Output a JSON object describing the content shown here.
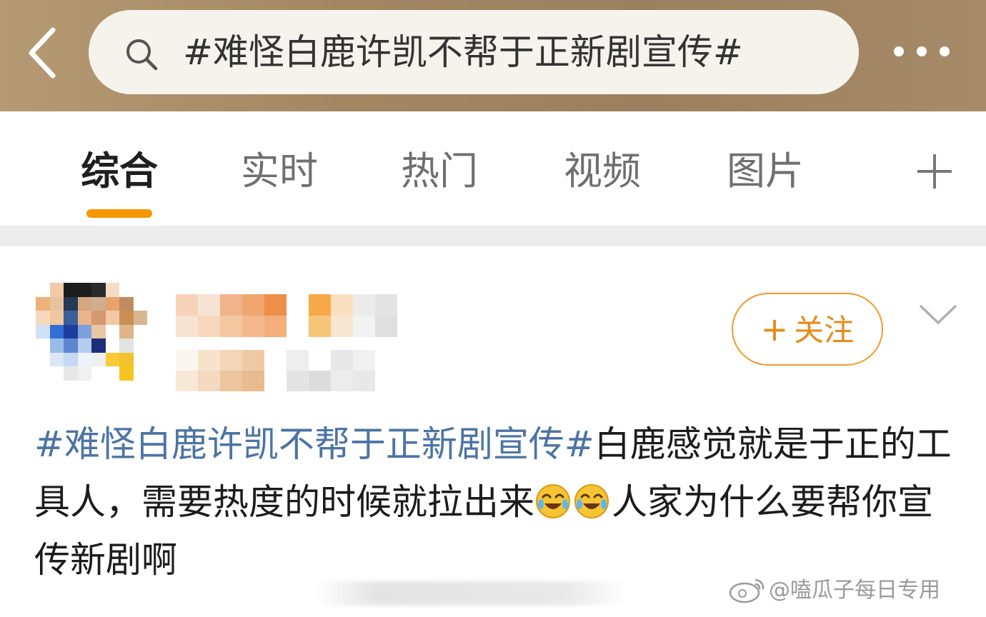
{
  "search": {
    "query": "#难怪白鹿许凯不帮于正新剧宣传#",
    "back_icon": "chevron-left-icon",
    "search_icon": "search-icon",
    "more_icon": "more-horizontal-icon"
  },
  "tabs": [
    {
      "label": "综合",
      "active": true
    },
    {
      "label": "实时",
      "active": false
    },
    {
      "label": "热门",
      "active": false
    },
    {
      "label": "视频",
      "active": false
    },
    {
      "label": "图片",
      "active": false
    }
  ],
  "add_tab_icon": "plus-icon",
  "post": {
    "follow_label": "关注",
    "follow_icon": "plus-icon",
    "menu_icon": "chevron-down-icon",
    "topic": "#难怪白鹿许凯不帮于正新剧宣传#",
    "text_part1": "白鹿感觉就是于正的工具人，需要热度的时候就拉出来",
    "emoji": "laugh-cry-emoji",
    "text_part2": "人家为什么要帮你宣传新剧啊"
  },
  "watermark": {
    "text": "@嗑瓜子每日专用"
  },
  "colors": {
    "accent_orange": "#f39800",
    "topic_blue": "#4c74a4",
    "header_bg": "#a48663"
  }
}
